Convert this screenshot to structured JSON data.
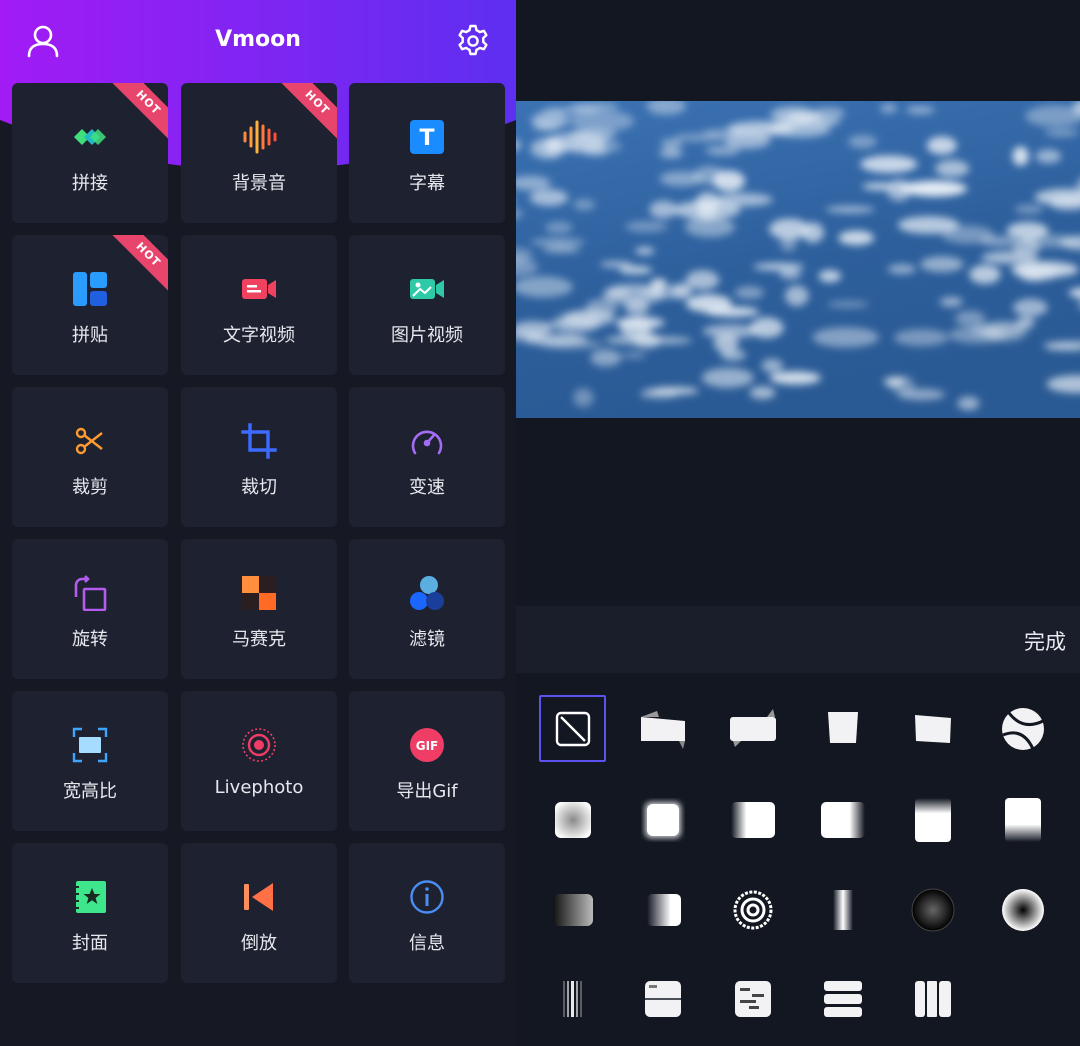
{
  "header": {
    "title": "Vmoon",
    "user_icon": "user-icon",
    "settings_icon": "gear-icon"
  },
  "tools": [
    {
      "label": "拼接",
      "icon": "stitch-icon",
      "hot": true
    },
    {
      "label": "背景音",
      "icon": "audio-wave-icon",
      "hot": true
    },
    {
      "label": "字幕",
      "icon": "text-t-icon",
      "hot": false
    },
    {
      "label": "拼贴",
      "icon": "collage-icon",
      "hot": true
    },
    {
      "label": "文字视频",
      "icon": "text-video-icon",
      "hot": false
    },
    {
      "label": "图片视频",
      "icon": "photo-video-icon",
      "hot": false
    },
    {
      "label": "裁剪",
      "icon": "scissors-icon",
      "hot": false
    },
    {
      "label": "裁切",
      "icon": "crop-icon",
      "hot": false
    },
    {
      "label": "变速",
      "icon": "speedometer-icon",
      "hot": false
    },
    {
      "label": "旋转",
      "icon": "rotate-icon",
      "hot": false
    },
    {
      "label": "马赛克",
      "icon": "mosaic-icon",
      "hot": false
    },
    {
      "label": "滤镜",
      "icon": "filter-icon",
      "hot": false
    },
    {
      "label": "宽高比",
      "icon": "aspect-ratio-icon",
      "hot": false
    },
    {
      "label": "Livephoto",
      "icon": "livephoto-icon",
      "hot": false
    },
    {
      "label": "导出Gif",
      "icon": "gif-icon",
      "hot": false
    },
    {
      "label": "封面",
      "icon": "cover-icon",
      "hot": false
    },
    {
      "label": "倒放",
      "icon": "reverse-icon",
      "hot": false
    },
    {
      "label": "信息",
      "icon": "info-icon",
      "hot": false
    }
  ],
  "hot_badge": "HOT",
  "editor": {
    "done_label": "完成"
  },
  "transitions": [
    "none-icon",
    "flip-left-icon",
    "flip-right-icon",
    "fold-icon",
    "tilt-icon",
    "swirl-icon",
    "blur-square-icon",
    "glow-square-icon",
    "fade-left-icon",
    "fade-right-icon",
    "fade-bottom-icon",
    "fade-top-icon",
    "gradient-horizontal-icon",
    "gradient-left-icon",
    "rings-icon",
    "stripe-center-icon",
    "dark-sphere-icon",
    "light-sphere-icon",
    "blinds-icon",
    "split-h-icon",
    "text-lines-icon",
    "bars-icon",
    "columns-icon"
  ],
  "colors": {
    "accent": "#5b52f0",
    "hot": "#e8456c",
    "tile": "#1e2230",
    "gradient_start": "#9c1af5",
    "gradient_end": "#6b2ef0"
  }
}
